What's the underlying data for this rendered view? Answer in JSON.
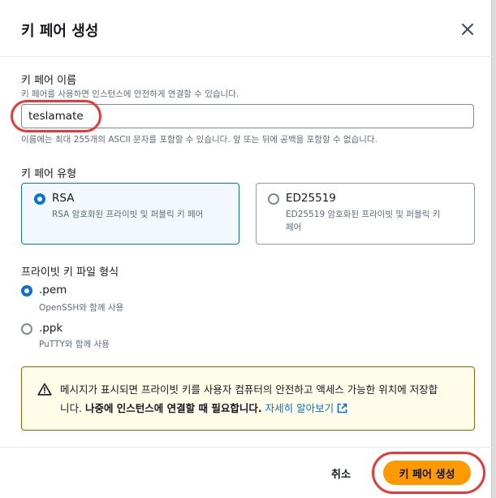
{
  "dialog": {
    "title": "키 페어 생성",
    "close_icon": "close-icon"
  },
  "name_section": {
    "label": "키 페어 이름",
    "description": "키 페어를 사용하면 인스턴스에 안전하게 연결할 수 있습니다.",
    "value": "teslamate",
    "constraint": "이름에는 최대 255개의 ASCII 문자를 포함할 수 있습니다. 앞 또는 뒤에 공백을 포함할 수 없습니다."
  },
  "type_section": {
    "label": "키 페어 유형",
    "options": [
      {
        "title": "RSA",
        "description": "RSA 암호화된 프라이빗 및 퍼블릭 키 페어",
        "selected": true
      },
      {
        "title": "ED25519",
        "description_line1": "ED25519 암호화된 프라이빗 및 퍼블릭 키",
        "description_line2": "페어",
        "selected": false
      }
    ]
  },
  "format_section": {
    "label": "프라이빗 키 파일 형식",
    "options": [
      {
        "title": ".pem",
        "description": "OpenSSH와 함께 사용",
        "selected": true
      },
      {
        "title": ".ppk",
        "description": "PuTTY와 함께 사용",
        "selected": false
      }
    ]
  },
  "alert": {
    "icon": "warning-icon",
    "line1": "메시지가 표시되면 프라이빗 키를 사용자 컴퓨터의 안전하고 액세스 가능한 위치에 저장합",
    "line2_prefix": "니다. ",
    "line2_bold": "나중에 인스턴스에 연결할 때 필요합니다.",
    "link": "자세히 알아보기",
    "link_icon": "external-link-icon"
  },
  "footer": {
    "cancel_label": "취소",
    "create_label": "키 페어 생성"
  },
  "colors": {
    "primary": "#ff9900",
    "accent": "#0972d3",
    "highlight": "#e53a3a",
    "alert_bg": "#fffce9",
    "alert_border": "#8d6605"
  }
}
